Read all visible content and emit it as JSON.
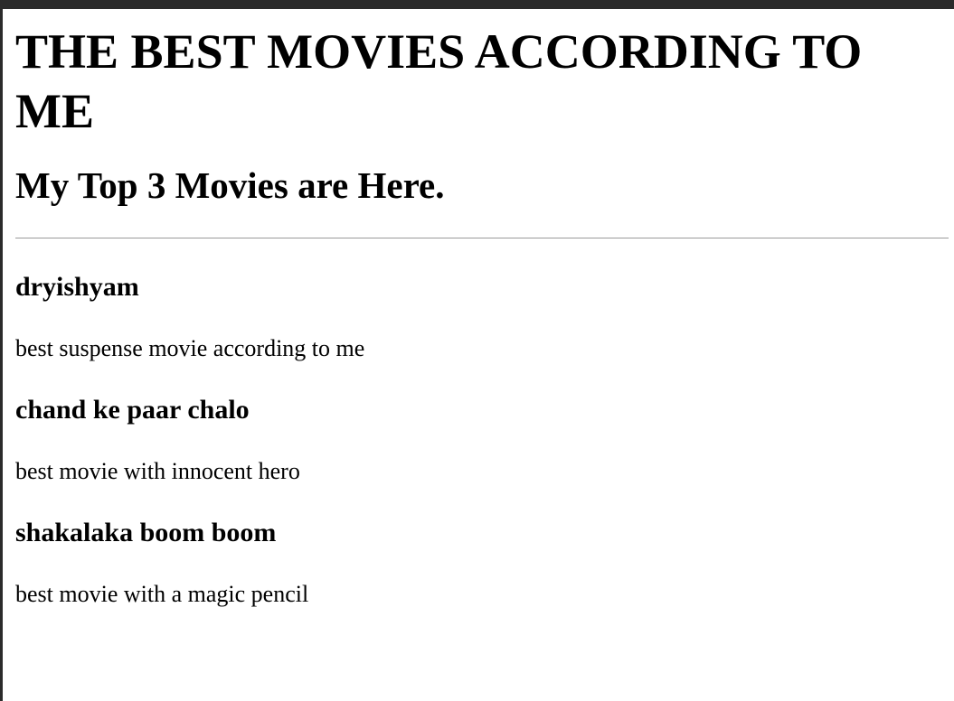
{
  "page": {
    "title": "THE BEST MOVIES ACCORDING TO ME",
    "subtitle": "My Top 3 Movies are Here."
  },
  "movies": [
    {
      "title": "dryishyam",
      "description": "best suspense movie according to me"
    },
    {
      "title": "chand ke paar chalo",
      "description": "best movie with innocent hero"
    },
    {
      "title": "shakalaka boom boom",
      "description": "best movie with a magic pencil"
    }
  ],
  "colors": {
    "background": "#ffffff",
    "text": "#000000",
    "frame": "#2b2b2b",
    "divider": "#9a9a9a"
  }
}
